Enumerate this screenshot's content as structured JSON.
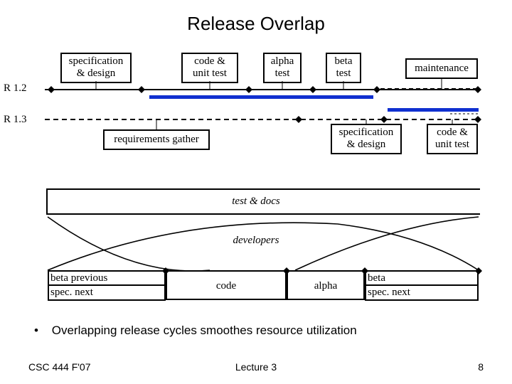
{
  "title": "Release Overlap",
  "r12": {
    "label": "R 1.2",
    "phases": {
      "spec_design": "specification\n& design",
      "code_unit": "code &\nunit test",
      "alpha": "alpha\ntest",
      "beta": "beta\ntest",
      "maintenance": "maintenance"
    }
  },
  "r13": {
    "label": "R 1.3",
    "phases": {
      "req_gather": "requirements gather",
      "spec_design": "specification\n& design",
      "code_unit": "code &\nunit test"
    }
  },
  "bands": {
    "test_docs": "test & docs",
    "developers": "developers"
  },
  "bottom": {
    "beta_prev": "beta previous",
    "spec_next_left": "spec. next",
    "code": "code",
    "alpha": "alpha",
    "beta": "beta",
    "spec_next_right": "spec. next"
  },
  "bullet": "Overlapping release cycles smoothes resource utilization",
  "footer": {
    "left": "CSC 444 F'07",
    "center": "Lecture 3",
    "right": "8"
  }
}
